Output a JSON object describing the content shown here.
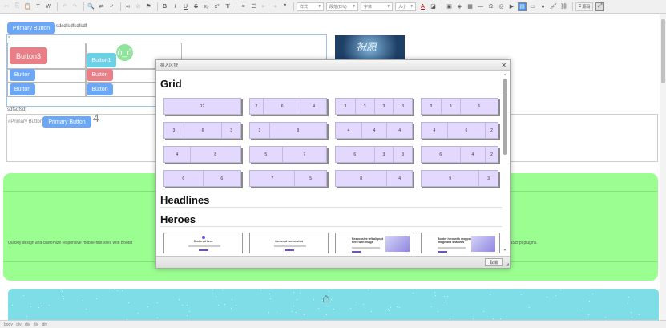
{
  "toolbar": {
    "combo_style": "样式",
    "combo_paragraph": "段落(DIV)",
    "combo_font": "字体",
    "combo_size": "大小",
    "source_label": "源码",
    "colors": {
      "bg": "#f0f0f0"
    }
  },
  "canvas": {
    "primary_button_top": "Primary Button",
    "top_text": "sdsdfsdfsdfsdf",
    "table_small_label": "s",
    "button3": "Button3",
    "button1": "Button1",
    "button": "Button",
    "under_table_text": "sdfsdfsdf",
    "primary_inline_text": "#Primary Button",
    "primary_button_2": "Primary Button",
    "number_four": "4",
    "green_text_left": "Quickly design and customize responsive mobile-first sites with Bootst",
    "green_text_right": "vaScript plugins.",
    "image_text": "祝愿",
    "accent_green": "#9bfe91",
    "accent_blue": "#6ba7f5"
  },
  "dialog": {
    "title": "插入区块",
    "close_glyph": "✕",
    "grid_heading": "Grid",
    "headlines_heading": "Headlines",
    "heroes_heading": "Heroes",
    "cancel_label": "取消",
    "grid_rows": [
      [
        [
          "12"
        ],
        [
          "2",
          "6",
          "4"
        ],
        [
          "3",
          "3",
          "3",
          "3"
        ],
        [
          "3",
          "3",
          "6"
        ]
      ],
      [
        [
          "3",
          "6",
          "3"
        ],
        [
          "3",
          "9"
        ],
        [
          "4",
          "4",
          "4"
        ],
        [
          "4",
          "6",
          "2"
        ]
      ],
      [
        [
          "4",
          "8"
        ],
        [
          "5",
          "7"
        ],
        [
          "6",
          "3",
          "3"
        ],
        [
          "6",
          "4",
          "2"
        ]
      ],
      [
        [
          "6",
          "6"
        ],
        [
          "7",
          "5"
        ],
        [
          "8",
          "4"
        ],
        [
          "9",
          "3"
        ]
      ]
    ],
    "heroes": [
      {
        "title": "Centered hero"
      },
      {
        "title": "Centered screenshot"
      },
      {
        "title": "Responsive left-aligned hero with image"
      },
      {
        "title": "Border hero with cropped image and shadows"
      }
    ]
  },
  "statusbar": {
    "path": "body  div  div  div  div"
  }
}
